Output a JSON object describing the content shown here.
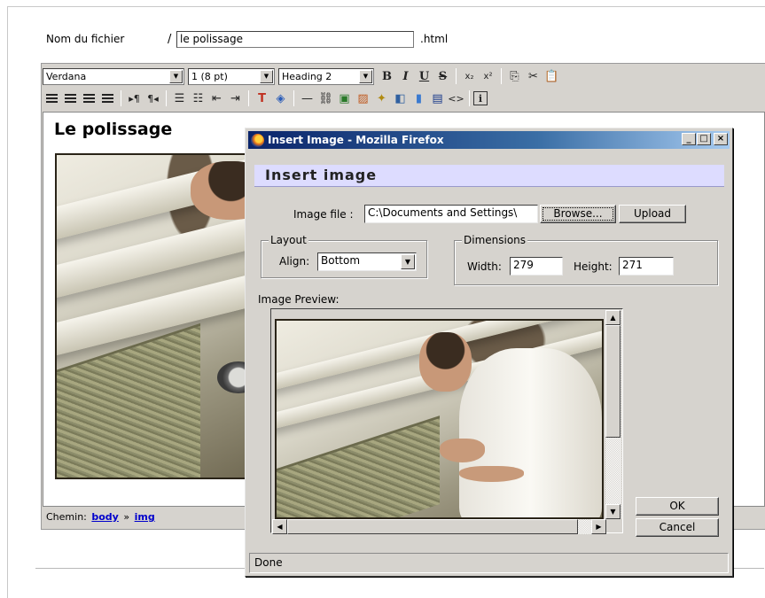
{
  "filename": {
    "label": "Nom du fichier",
    "slash": "/",
    "value": "le polissage",
    "extension": ".html"
  },
  "toolbar": {
    "font_family": "Verdana",
    "font_size": "1 (8 pt)",
    "block_format": "Heading 2",
    "bold": "B",
    "italic": "I",
    "underline": "U",
    "strikethrough": "S",
    "subscript": "x₂",
    "superscript": "x²",
    "html_source": "<>",
    "about": "i"
  },
  "document": {
    "title": "Le polissage"
  },
  "statusbar": {
    "label": "Chemin:",
    "path": [
      "body",
      "img"
    ],
    "separator": "»"
  },
  "dialog": {
    "window_title": "Insert Image - Mozilla Firefox",
    "minimize": "_",
    "maximize": "□",
    "close": "×",
    "heading": "Insert image",
    "image_file_label": "Image file :",
    "image_file_value": "C:\\Documents and Settings\\",
    "browse_label": "Browse...",
    "upload_label": "Upload",
    "layout_legend": "Layout",
    "align_label": "Align:",
    "align_value": "Bottom",
    "dimensions_legend": "Dimensions",
    "width_label": "Width:",
    "width_value": "279",
    "height_label": "Height:",
    "height_value": "271",
    "preview_label": "Image Preview:",
    "ok_label": "OK",
    "cancel_label": "Cancel",
    "status": "Done"
  }
}
